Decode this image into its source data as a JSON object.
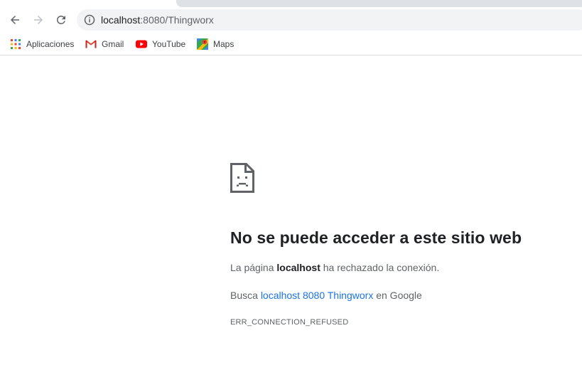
{
  "toolbar": {
    "url_host": "localhost",
    "url_rest": ":8080/Thingworx"
  },
  "bookmarks": [
    {
      "label": "Aplicaciones",
      "icon": "apps-grid-icon"
    },
    {
      "label": "Gmail",
      "icon": "gmail-icon"
    },
    {
      "label": "YouTube",
      "icon": "youtube-icon"
    },
    {
      "label": "Maps",
      "icon": "maps-icon"
    }
  ],
  "error": {
    "icon": "sad-page-icon",
    "title": "No se puede acceder a este sitio web",
    "desc_prefix": "La página ",
    "desc_host": "localhost",
    "desc_suffix": " ha rechazado la conexión.",
    "search_prefix": "Busca ",
    "search_link": "localhost 8080 Thingworx",
    "search_suffix": " en Google",
    "code": "ERR_CONNECTION_REFUSED"
  },
  "colors": {
    "link": "#1a73e8",
    "omnibox_bg": "#f1f3f4",
    "tabstrip_bg": "#dee1e6"
  }
}
